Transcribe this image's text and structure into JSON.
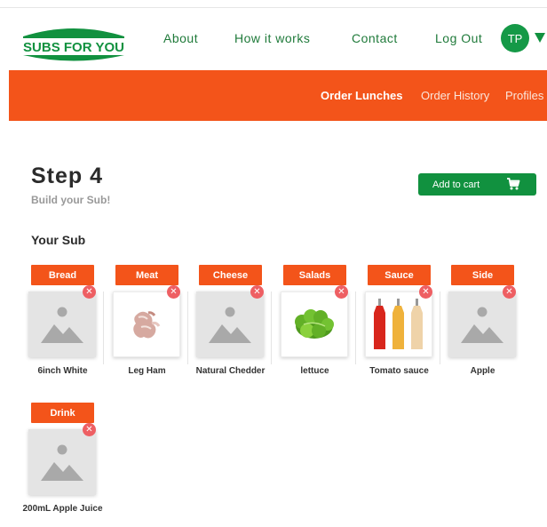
{
  "header": {
    "logo_text": "SUBS FOR YOU",
    "nav": [
      "About",
      "How it works",
      "Contact",
      "Log Out"
    ],
    "avatar_initials": "TP"
  },
  "banner": {
    "links": [
      "Order Lunches",
      "Order History",
      "Profiles"
    ],
    "active": "Order Lunches"
  },
  "page": {
    "step_title": "Step 4",
    "step_subtitle": "Build your Sub!",
    "add_to_cart_label": "Add to cart",
    "your_sub_heading": "Your Sub"
  },
  "items": [
    {
      "category": "Bread",
      "name": "6inch White",
      "image": "placeholder-icon"
    },
    {
      "category": "Meat",
      "name": "Leg Ham",
      "image": "ham-image"
    },
    {
      "category": "Cheese",
      "name": "Natural Chedder",
      "image": "placeholder-icon"
    },
    {
      "category": "Salads",
      "name": "lettuce",
      "image": "lettuce-image"
    },
    {
      "category": "Sauce",
      "name": "Tomato sauce",
      "image": "sauce-bottles-image"
    },
    {
      "category": "Side",
      "name": "Apple",
      "image": "placeholder-icon"
    },
    {
      "category": "Drink",
      "name": "200mL Apple Juice",
      "image": "placeholder-icon"
    }
  ],
  "colors": {
    "brand_green": "#11913f",
    "banner_orange": "#f3541a",
    "remove_red": "#ee5f63"
  }
}
